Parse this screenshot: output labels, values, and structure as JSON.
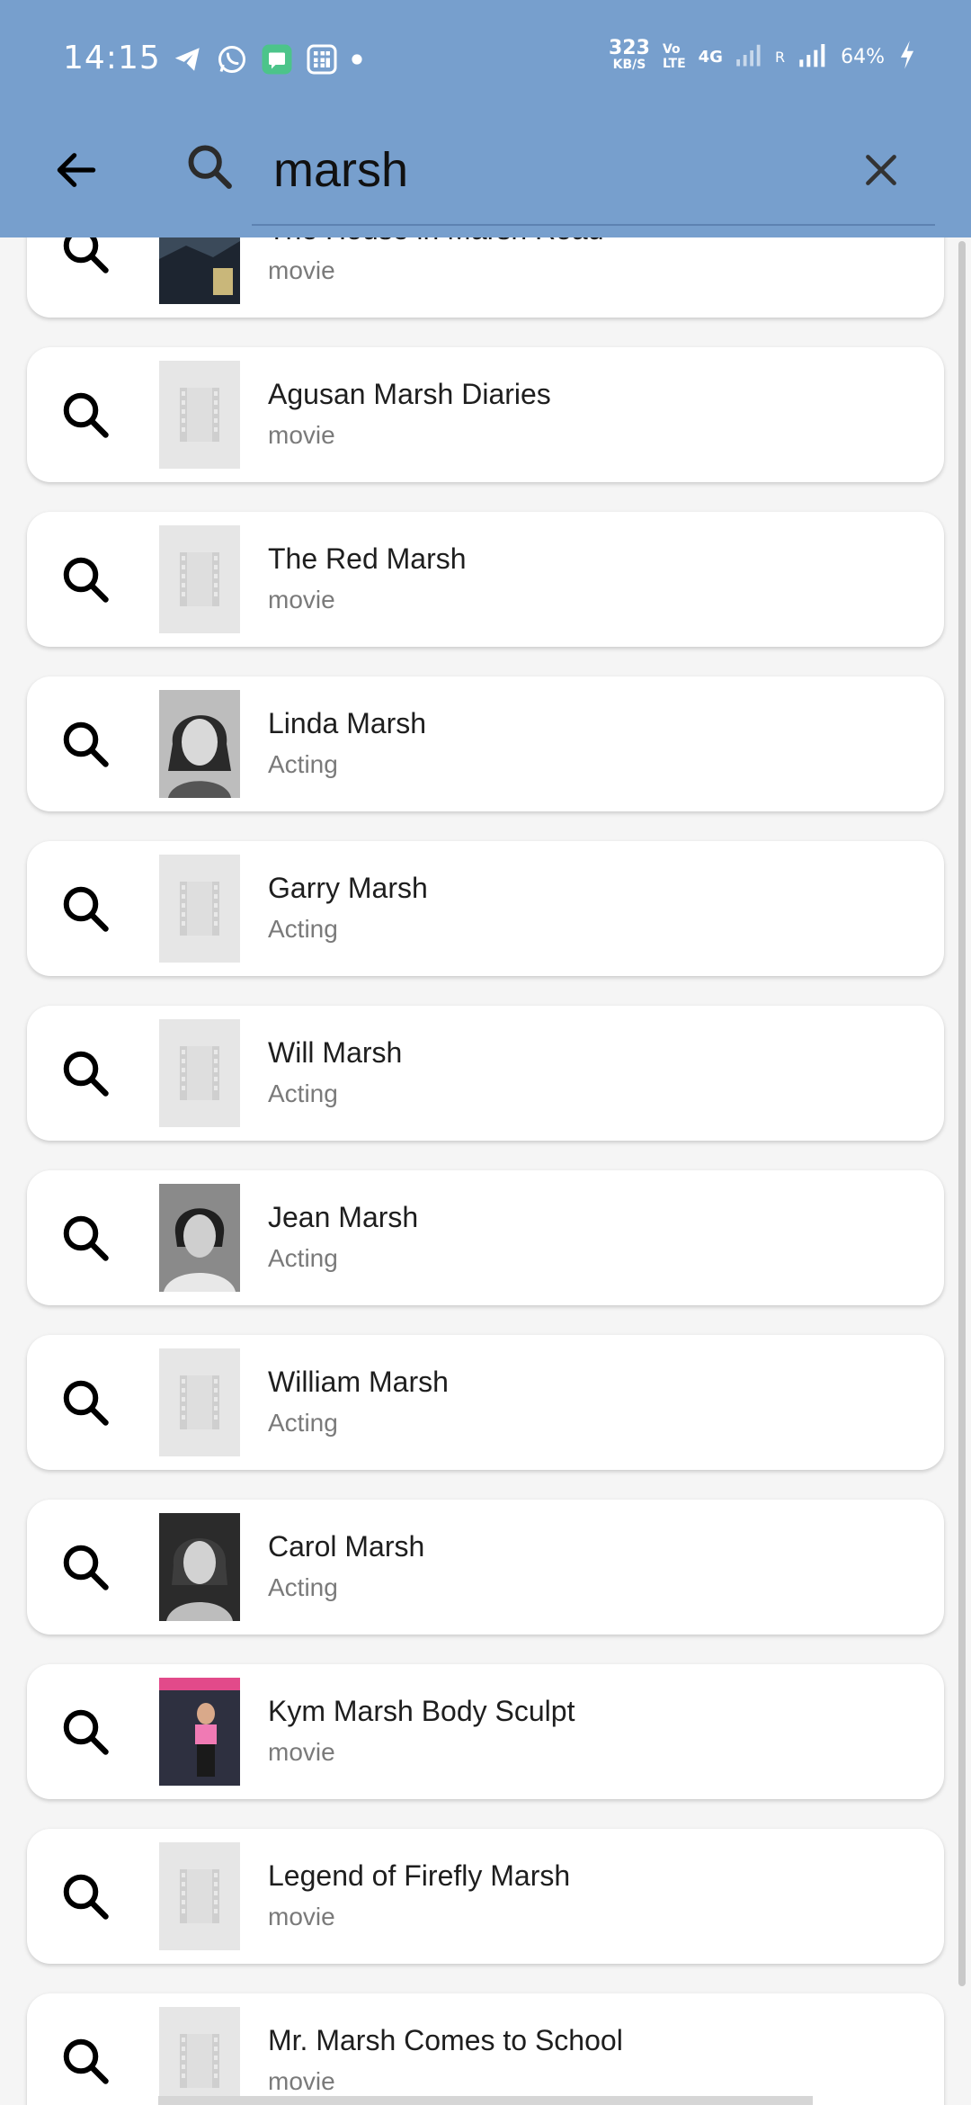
{
  "status_bar": {
    "time": "14:15",
    "net_speed_value": "323",
    "net_speed_unit": "KB/S",
    "volte_top": "Vo",
    "volte_bottom": "LTE",
    "network": "4G",
    "roaming": "R",
    "battery": "64%",
    "icons": [
      "telegram-icon",
      "whatsapp-icon",
      "messages-icon",
      "calculator-icon",
      "dot-icon",
      "signal-icon",
      "battery-charging-icon"
    ]
  },
  "search": {
    "query": "marsh",
    "placeholder": ""
  },
  "results": [
    {
      "title": "The House in Marsh Road",
      "subtitle": "movie",
      "thumb": "poster"
    },
    {
      "title": "Agusan Marsh Diaries",
      "subtitle": "movie",
      "thumb": "placeholder"
    },
    {
      "title": "The Red Marsh",
      "subtitle": "movie",
      "thumb": "placeholder"
    },
    {
      "title": "Linda Marsh",
      "subtitle": "Acting",
      "thumb": "photo"
    },
    {
      "title": "Garry Marsh",
      "subtitle": "Acting",
      "thumb": "placeholder"
    },
    {
      "title": "Will Marsh",
      "subtitle": "Acting",
      "thumb": "placeholder"
    },
    {
      "title": "Jean Marsh",
      "subtitle": "Acting",
      "thumb": "photo"
    },
    {
      "title": "William Marsh",
      "subtitle": "Acting",
      "thumb": "placeholder"
    },
    {
      "title": "Carol Marsh",
      "subtitle": "Acting",
      "thumb": "photo"
    },
    {
      "title": "Kym Marsh Body Sculpt",
      "subtitle": "movie",
      "thumb": "poster"
    },
    {
      "title": "Legend of Firefly Marsh",
      "subtitle": "movie",
      "thumb": "placeholder"
    },
    {
      "title": "Mr. Marsh Comes to School",
      "subtitle": "movie",
      "thumb": "placeholder"
    }
  ],
  "colors": {
    "header_bg": "#779fcd",
    "card_bg": "#ffffff",
    "page_bg": "#f5f5f5",
    "subtitle": "#7a7a7a"
  }
}
